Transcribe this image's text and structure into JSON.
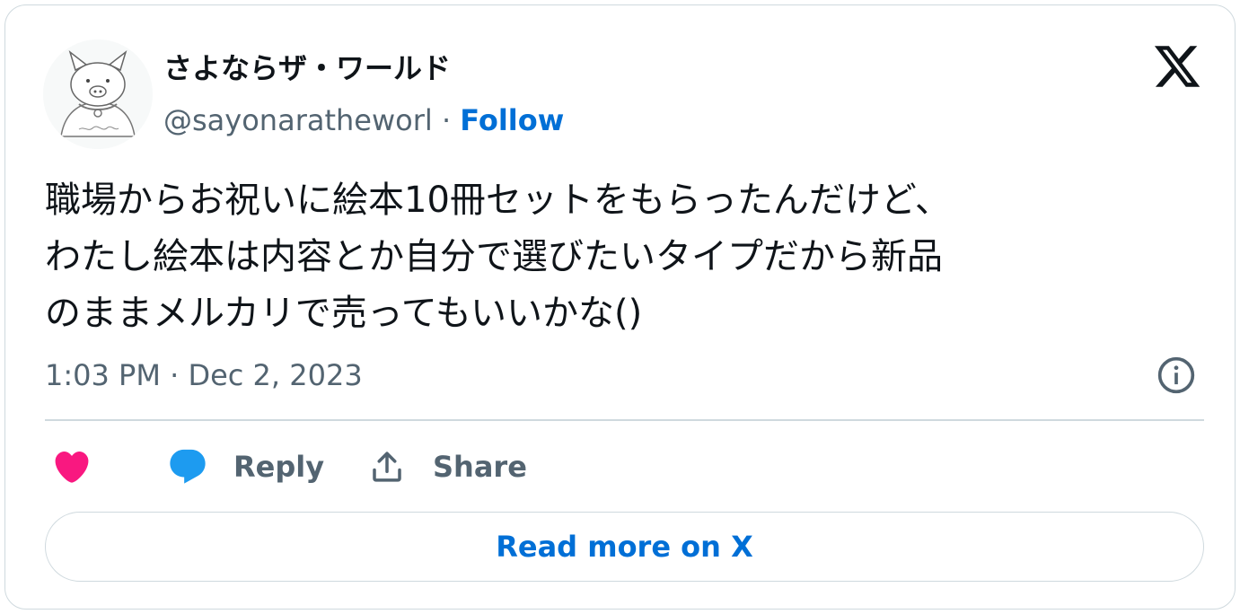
{
  "author": {
    "display_name": "さよならザ・ワールド",
    "handle": "@sayonaratheworl",
    "separator": "·",
    "follow_label": "Follow",
    "avatar_caption": "sayonaraworld"
  },
  "tweet": {
    "lines": [
      "職場からお祝いに絵本10冊セットをもらったんだけど、",
      "わたし絵本は内容とか自分で選びたいタイプだから新品",
      "のままメルカリで売ってもいいかな()"
    ],
    "timestamp": "1:03 PM · Dec 2, 2023"
  },
  "actions": {
    "like_icon": "heart-icon",
    "reply_label": "Reply",
    "reply_icon": "speech-bubble-icon",
    "share_label": "Share",
    "share_icon": "upload-icon"
  },
  "read_more_label": "Read more on X",
  "icons": {
    "brand": "x-logo-icon",
    "info": "info-icon"
  },
  "colors": {
    "accent": "#006fd6",
    "like": "#f91880",
    "reply": "#1d9bf0",
    "secondary_text": "#536471",
    "border": "#cfd9de"
  }
}
